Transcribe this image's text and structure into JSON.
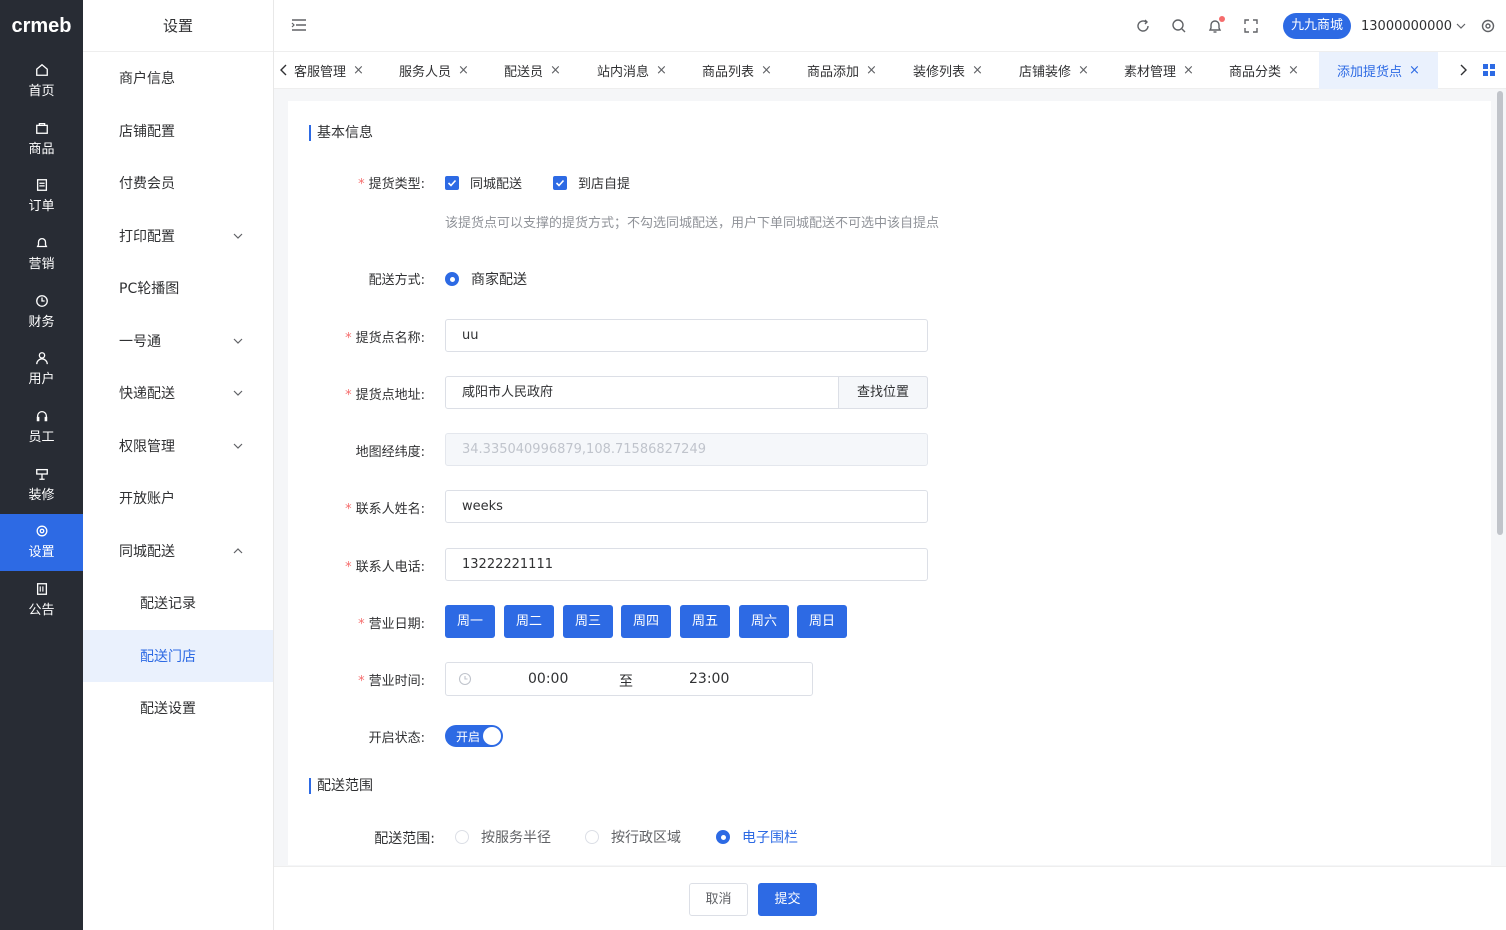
{
  "brand": {
    "logo_text": "crmeb",
    "accent": "#2d6ae4",
    "rail_bg": "#282c34"
  },
  "rail": {
    "items": [
      {
        "label": "首页",
        "icon": "home-icon"
      },
      {
        "label": "商品",
        "icon": "bag-icon"
      },
      {
        "label": "订单",
        "icon": "order-icon"
      },
      {
        "label": "营销",
        "icon": "bell-icon"
      },
      {
        "label": "财务",
        "icon": "clock-icon"
      },
      {
        "label": "用户",
        "icon": "user-icon"
      },
      {
        "label": "员工",
        "icon": "headset-icon"
      },
      {
        "label": "装修",
        "icon": "decorate-icon"
      },
      {
        "label": "设置",
        "icon": "gear-icon",
        "active": true
      },
      {
        "label": "公告",
        "icon": "notice-icon"
      }
    ]
  },
  "submenu": {
    "title": "设置",
    "items": [
      {
        "label": "商户信息"
      },
      {
        "label": "店铺配置"
      },
      {
        "label": "付费会员"
      },
      {
        "label": "打印配置",
        "expandable": true
      },
      {
        "label": "PC轮播图"
      },
      {
        "label": "一号通",
        "expandable": true
      },
      {
        "label": "快递配送",
        "expandable": true
      },
      {
        "label": "权限管理",
        "expandable": true
      },
      {
        "label": "开放账户"
      },
      {
        "label": "同城配送",
        "expandable": true,
        "expanded": true
      },
      {
        "label": "配送记录",
        "sub": true
      },
      {
        "label": "配送门店",
        "sub": true,
        "active": true
      },
      {
        "label": "配送设置",
        "sub": true
      }
    ]
  },
  "header": {
    "shop_name": "九九商城",
    "phone": "13000000000"
  },
  "tabs": {
    "items": [
      {
        "label": "客服管理"
      },
      {
        "label": "服务人员"
      },
      {
        "label": "配送员"
      },
      {
        "label": "站内消息"
      },
      {
        "label": "商品列表"
      },
      {
        "label": "商品添加"
      },
      {
        "label": "装修列表"
      },
      {
        "label": "店铺装修"
      },
      {
        "label": "素材管理"
      },
      {
        "label": "商品分类"
      },
      {
        "label": "添加提货点",
        "active": true
      }
    ],
    "close_glyph": "×"
  },
  "form": {
    "section_basic": "基本信息",
    "pickup_type": {
      "label": "提货类型:",
      "options": [
        "同城配送",
        "到店自提"
      ],
      "hint": "该提货点可以支撑的提货方式；不勾选同城配送，用户下单同城配送不可选中该自提点"
    },
    "delivery_method": {
      "label": "配送方式:",
      "option": "商家配送"
    },
    "point_name": {
      "label": "提货点名称:",
      "value": "uu"
    },
    "address": {
      "label": "提货点地址:",
      "value": "咸阳市人民政府",
      "button": "查找位置"
    },
    "coords": {
      "label": "地图经纬度:",
      "value": "34.335040996879,108.71586827249"
    },
    "contact_name": {
      "label": "联系人姓名:",
      "value": "weeks"
    },
    "contact_phone": {
      "label": "联系人电话:",
      "value": "13222221111"
    },
    "business_days": {
      "label": "营业日期:",
      "days": [
        "周一",
        "周二",
        "周三",
        "周四",
        "周五",
        "周六",
        "周日"
      ]
    },
    "business_hours": {
      "label": "营业时间:",
      "start": "00:00",
      "separator": "至",
      "end": "23:00"
    },
    "status": {
      "label": "开启状态:",
      "switch_text": "开启",
      "on": true
    },
    "section_range": "配送范围",
    "range": {
      "label": "配送范围:",
      "options": [
        "按服务半径",
        "按行政区域",
        "电子围栏"
      ],
      "selected": "电子围栏"
    }
  },
  "footer": {
    "cancel": "取消",
    "submit": "提交"
  }
}
